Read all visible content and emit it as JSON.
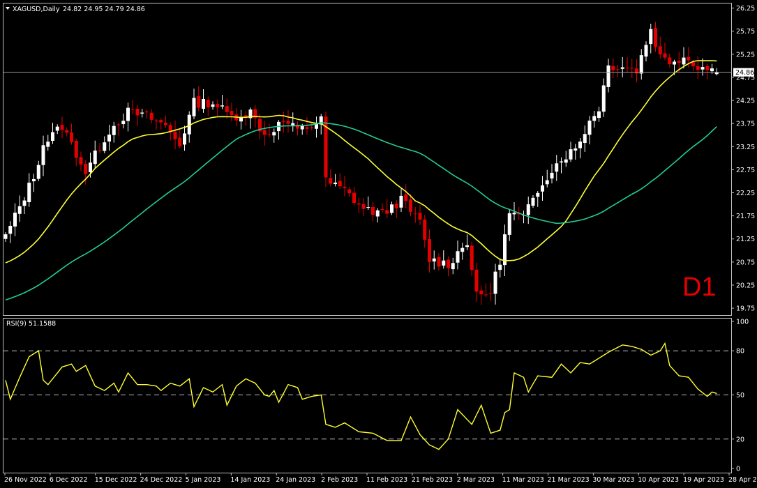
{
  "header": {
    "symbol": "XAGUSD,Daily",
    "ohlc": "24.82 24.95 24.79 24.86"
  },
  "timeframe_label": "D1",
  "colors": {
    "background": "#000000",
    "bull_candle": "#ffffff",
    "bear_candle": "#e50000",
    "ma_fast": "#ffff33",
    "ma_slow": "#22cc99",
    "rsi_line": "#ffff33",
    "grid": "#bfbfbf"
  },
  "chart_data": [
    {
      "type": "candlestick",
      "title": "XAGUSD,Daily",
      "ylim": [
        19.6,
        26.35
      ],
      "y_ticks": [
        "26.25",
        "25.75",
        "25.25",
        "24.75",
        "24.25",
        "23.75",
        "23.25",
        "22.75",
        "22.25",
        "21.75",
        "21.25",
        "20.75",
        "20.25",
        "19.75"
      ],
      "x_ticks": [
        "26 Nov 2022",
        "6 Dec 2022",
        "15 Dec 2022",
        "24 Dec 2022",
        "5 Jan 2023",
        "14 Jan 2023",
        "24 Jan 2023",
        "2 Feb 2023",
        "11 Feb 2023",
        "21 Feb 2023",
        "2 Mar 2023",
        "11 Mar 2023",
        "21 Mar 2023",
        "30 Mar 2023",
        "10 Apr 2023",
        "19 Apr 2023",
        "28 Apr 2023"
      ],
      "current_price": "24.86",
      "grid": false,
      "close_waypoints": [
        [
          0,
          21.3
        ],
        [
          6,
          22.6
        ],
        [
          8,
          23.3
        ],
        [
          12,
          23.7
        ],
        [
          17,
          22.7
        ],
        [
          22,
          23.6
        ],
        [
          26,
          24.0
        ],
        [
          30,
          23.9
        ],
        [
          34,
          23.7
        ],
        [
          37,
          23.3
        ],
        [
          40,
          24.2
        ],
        [
          44,
          24.2
        ],
        [
          48,
          23.9
        ],
        [
          52,
          24.0
        ],
        [
          55,
          23.5
        ],
        [
          59,
          23.8
        ],
        [
          62,
          23.6
        ],
        [
          65,
          23.7
        ],
        [
          67,
          23.9
        ],
        [
          68,
          22.5
        ],
        [
          72,
          22.3
        ],
        [
          76,
          21.9
        ],
        [
          80,
          21.8
        ],
        [
          84,
          22.1
        ],
        [
          88,
          21.6
        ],
        [
          90,
          20.8
        ],
        [
          94,
          20.7
        ],
        [
          98,
          21.2
        ],
        [
          100,
          20.0
        ],
        [
          103,
          20.1
        ],
        [
          105,
          20.8
        ],
        [
          107,
          21.8
        ],
        [
          110,
          21.7
        ],
        [
          114,
          22.5
        ],
        [
          118,
          23.0
        ],
        [
          121,
          23.2
        ],
        [
          124,
          23.8
        ],
        [
          126,
          24.1
        ],
        [
          128,
          25.0
        ],
        [
          131,
          25.0
        ],
        [
          134,
          24.9
        ],
        [
          137,
          25.8
        ],
        [
          139,
          25.2
        ],
        [
          141,
          25.1
        ],
        [
          144,
          25.2
        ],
        [
          147,
          25.0
        ],
        [
          150,
          24.9
        ],
        [
          151,
          24.86
        ]
      ],
      "rsi_waypoints": [
        [
          0,
          60
        ],
        [
          1,
          47
        ],
        [
          3,
          62
        ],
        [
          5,
          76
        ],
        [
          7,
          80
        ],
        [
          8,
          60
        ],
        [
          9,
          57
        ],
        [
          12,
          69
        ],
        [
          14,
          71
        ],
        [
          15,
          66
        ],
        [
          17,
          70
        ],
        [
          19,
          56
        ],
        [
          21,
          53
        ],
        [
          23,
          58
        ],
        [
          24,
          52
        ],
        [
          26,
          65
        ],
        [
          28,
          57
        ],
        [
          30,
          57
        ],
        [
          32,
          56
        ],
        [
          33,
          53
        ],
        [
          35,
          58
        ],
        [
          37,
          56
        ],
        [
          39,
          61
        ],
        [
          40,
          42
        ],
        [
          42,
          55
        ],
        [
          44,
          52
        ],
        [
          46,
          57
        ],
        [
          47,
          43
        ],
        [
          49,
          56
        ],
        [
          51,
          61
        ],
        [
          53,
          58
        ],
        [
          55,
          50
        ],
        [
          56,
          49
        ],
        [
          57,
          53
        ],
        [
          58,
          45
        ],
        [
          60,
          57
        ],
        [
          62,
          55
        ],
        [
          63,
          47
        ],
        [
          65,
          49
        ],
        [
          67,
          50
        ],
        [
          68,
          30
        ],
        [
          70,
          28
        ],
        [
          72,
          31
        ],
        [
          75,
          25
        ],
        [
          78,
          24
        ],
        [
          81,
          19
        ],
        [
          84,
          19
        ],
        [
          86,
          35
        ],
        [
          88,
          23
        ],
        [
          90,
          16
        ],
        [
          92,
          13
        ],
        [
          94,
          20
        ],
        [
          96,
          40
        ],
        [
          99,
          30
        ],
        [
          101,
          43
        ],
        [
          103,
          24
        ],
        [
          105,
          26
        ],
        [
          106,
          38
        ],
        [
          107,
          40
        ],
        [
          108,
          65
        ],
        [
          110,
          62
        ],
        [
          111,
          52
        ],
        [
          113,
          63
        ],
        [
          116,
          62
        ],
        [
          118,
          71
        ],
        [
          120,
          65
        ],
        [
          122,
          72
        ],
        [
          124,
          71
        ],
        [
          126,
          75
        ],
        [
          128,
          79
        ],
        [
          131,
          84
        ],
        [
          133,
          83
        ],
        [
          135,
          81
        ],
        [
          137,
          77
        ],
        [
          139,
          80
        ],
        [
          140,
          85
        ],
        [
          141,
          70
        ],
        [
          143,
          63
        ],
        [
          145,
          62
        ],
        [
          147,
          54
        ],
        [
          149,
          49
        ],
        [
          150,
          52
        ],
        [
          151,
          51
        ]
      ],
      "series": [
        {
          "name": "",
          "kind": "ma",
          "period": 20,
          "color": "#ffff33"
        },
        {
          "name": "",
          "kind": "ma",
          "period": 50,
          "color": "#22cc99"
        }
      ]
    },
    {
      "type": "line",
      "title": "RSI(9) 51.1588",
      "ylim": [
        0,
        100
      ],
      "y_ticks": [
        "100",
        "80",
        "50",
        "20",
        "0"
      ],
      "levels": [
        80,
        50,
        20
      ],
      "series": [
        {
          "name": "",
          "color": "#ffff33"
        }
      ]
    }
  ]
}
